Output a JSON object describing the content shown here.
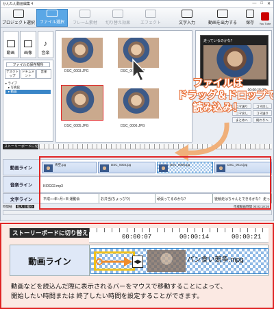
{
  "window": {
    "title": "かんたん動画編集 4",
    "controls": [
      "—",
      "□",
      "✕"
    ]
  },
  "toolbar": [
    {
      "label": "プロジェクト選択",
      "icon": "project-icon",
      "state": "normal"
    },
    {
      "label": "ファイル選択",
      "icon": "file-select-icon",
      "state": "active"
    },
    {
      "label": "フレーム素材",
      "icon": "frame-icon",
      "state": "disabled"
    },
    {
      "label": "切り替え効果",
      "icon": "transition-icon",
      "state": "disabled"
    },
    {
      "label": "エフェクト",
      "icon": "effect-icon",
      "state": "disabled"
    },
    {
      "label": "文字入力",
      "icon": "text-input-icon",
      "state": "normal"
    },
    {
      "label": "動画を出力する",
      "icon": "export-icon",
      "state": "normal"
    },
    {
      "label": "保存",
      "icon": "save-icon",
      "state": "normal"
    },
    {
      "label": "You Tube",
      "icon": "youtube-icon",
      "state": "normal"
    }
  ],
  "media_tabs": [
    {
      "label": "動画",
      "icon": "movie-icon"
    },
    {
      "label": "画像",
      "icon": "image-icon"
    },
    {
      "label": "音楽",
      "icon": "music-icon"
    }
  ],
  "file_tree": {
    "header": "ファイルの保存場所",
    "quick_buttons": [
      "デスクトップ",
      "ドキュメント",
      "音楽"
    ],
    "items": [
      "ライブ",
      "写真館",
      "動画"
    ]
  },
  "thumbnails": [
    "DSC_0003.JPG",
    "DSC_0004.JPG",
    "DSC_0005.JPG",
    "DSC_0006.JPG"
  ],
  "preview": {
    "time": "00:00:15:00",
    "caption": "走っているのかな？"
  },
  "side_buttons": [
    "コマ送り",
    "コマ戻し",
    "コマ戻し",
    "コマ送り",
    "まとめへ",
    "終わりへ"
  ],
  "callout": {
    "line1": "ファイルは",
    "line2": "ドラッグ＆ドロップで",
    "line3": "読み込み！"
  },
  "timeline": {
    "storyboard_button": "ストーリーボードに切り替え",
    "tracks": [
      {
        "label": "動画ライン",
        "clips": [
          "青空.jpg",
          "DSC_0003.jpg",
          "DSC_0005.jpg",
          "DSC_0014.jpg"
        ]
      },
      {
        "label": "音楽ライン",
        "clips": [
          "KIDG02.mp3"
        ]
      },
      {
        "label": "文字ライン",
        "clips": [
          "平成○○年○月○日 運動会",
          "お弁当(ちょっぴり)",
          "頑張ってるのかな？",
          "徒競走はちゃんとできるかな？ 走ってる"
        ]
      }
    ],
    "status_left": "時間軸",
    "zoom_buttons": [
      "拡大",
      "縮小"
    ],
    "status_right": "作成動画時間 00:03:18:26"
  },
  "zoom": {
    "storyboard_button": "ストーリーボードに切り替え",
    "ticks": [
      "00:00:07",
      "00:00:14",
      "00:00:21"
    ],
    "track_label": "動画ライン",
    "clip_label": "パン食い競争.mpg",
    "description": [
      "動画などを読込んだ際に表示されるバーをマウスで移動することによって、",
      "開始したい時間または 終了したい時間を設定することができます。"
    ]
  }
}
